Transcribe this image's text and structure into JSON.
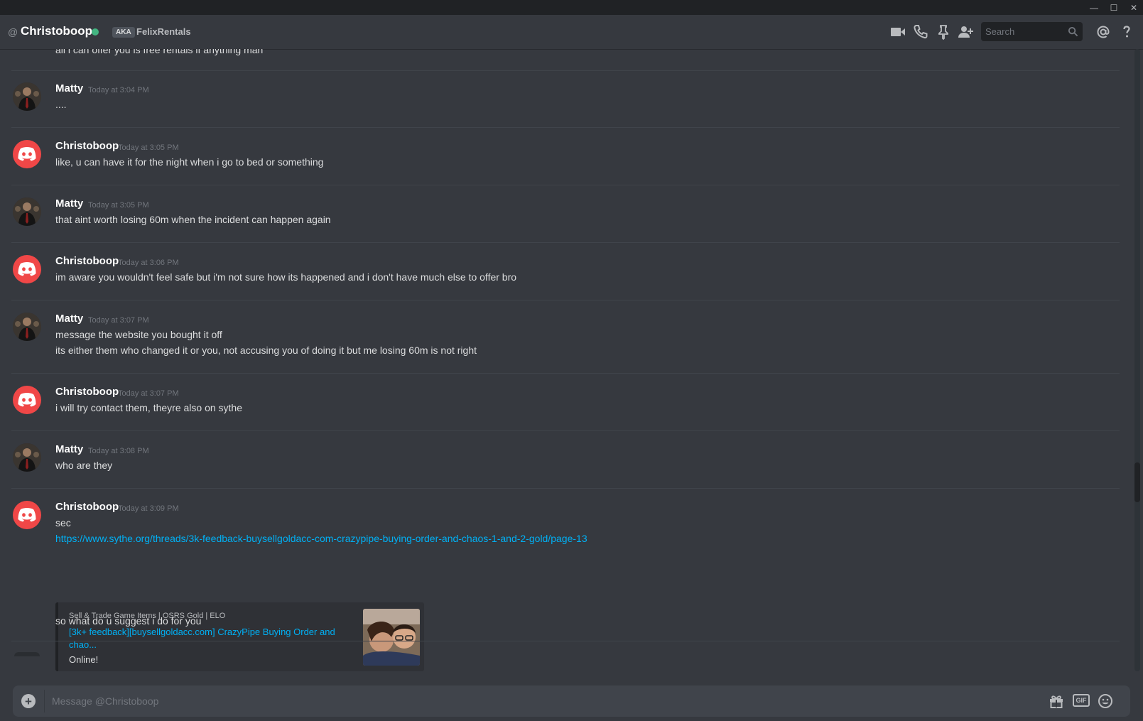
{
  "window": {
    "minimize": "—",
    "maximize": "☐",
    "close": "✕"
  },
  "header": {
    "at_symbol": "@",
    "username": "Christoboop",
    "aka_badge": "AKA",
    "aka_name": "FelixRentals",
    "search_placeholder": "Search",
    "icons": [
      "video-call-icon",
      "voice-call-icon",
      "pin-icon",
      "add-friend-icon",
      "mention-icon",
      "help-icon"
    ]
  },
  "chat": {
    "partial_line": "all i can offer you is free rentals if anything man",
    "messages": [
      {
        "author": "Matty",
        "timestamp": "Today at 3:04 PM",
        "lines": [
          "...."
        ]
      },
      {
        "author": "Christoboop",
        "timestamp": "Today at 3:05 PM",
        "lines": [
          "like, u can have it for the night when i go to bed or something"
        ]
      },
      {
        "author": "Matty",
        "timestamp": "Today at 3:05 PM",
        "lines": [
          "that aint worth losing 60m when the incident can happen again"
        ]
      },
      {
        "author": "Christoboop",
        "timestamp": "Today at 3:06 PM",
        "lines": [
          "im aware you wouldn't feel safe but i'm not sure how its happened and i don't have much else to offer bro"
        ]
      },
      {
        "author": "Matty",
        "timestamp": "Today at 3:07 PM",
        "lines": [
          "message the website you bought it off",
          "its either them who changed it or you, not accusing you of doing it but me losing 60m is not right"
        ]
      },
      {
        "author": "Christoboop",
        "timestamp": "Today at 3:07 PM",
        "lines": [
          "i will try contact them, theyre also on sythe"
        ]
      },
      {
        "author": "Matty",
        "timestamp": "Today at 3:08 PM",
        "lines": [
          "who are they"
        ]
      },
      {
        "author": "Christoboop",
        "timestamp": "Today at 3:09 PM",
        "lines": [
          "sec",
          "https://www.sythe.org/threads/3k-feedback-buysellgoldacc-com-crazypipe-buying-order-and-chaos-1-and-2-gold/page-13",
          "so what do u suggest i do for you"
        ]
      }
    ],
    "embed": {
      "provider": "Sell & Trade Game Items | OSRS Gold | ELO",
      "title": "[3k+ feedback][buysellgoldacc.com] CrazyPipe Buying Order and chao...",
      "description": "Online!"
    }
  },
  "composer": {
    "placeholder": "Message @Christoboop",
    "plus": "+",
    "gif_label": "GIF"
  },
  "colors": {
    "background": "#36393f",
    "titlebar": "#202225",
    "online": "#43b581",
    "discord_avatar": "#f04747",
    "link": "#00b0f4",
    "timestamp": "#72767d"
  }
}
